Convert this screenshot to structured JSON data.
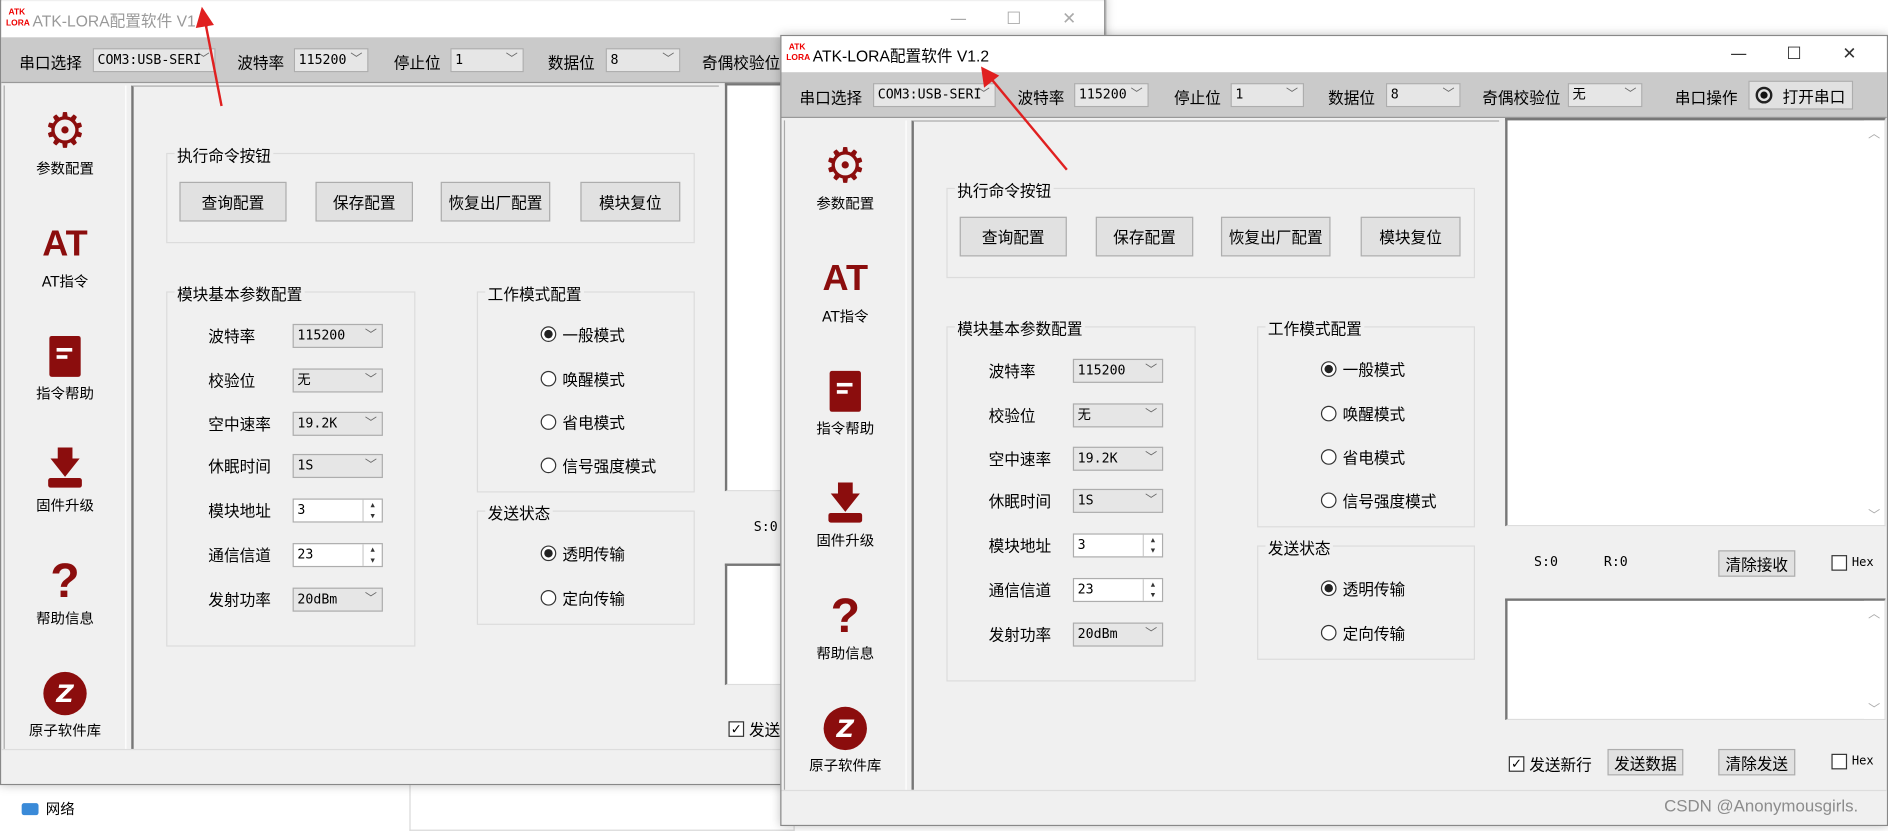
{
  "window": {
    "logo_text": "ATK LORA",
    "title": "ATK-LORA配置软件 V1.2",
    "minimize": "—",
    "maximize": "☐",
    "close": "✕"
  },
  "toolbar": {
    "port_label": "串口选择",
    "port_value": "COM3:USB-SERI",
    "baud_label": "波特率",
    "baud_value": "115200",
    "stop_label": "停止位",
    "stop_value": "1",
    "data_label": "数据位",
    "data_value": "8",
    "parity_label": "奇偶校验位",
    "parity_value": "无",
    "op_label": "串口操作",
    "open_button": "打开串口"
  },
  "sidebar": {
    "items": [
      {
        "label": "参数配置",
        "icon": "gear-icon"
      },
      {
        "label": "AT指令",
        "icon": "at-icon",
        "glyph": "AT"
      },
      {
        "label": "指令帮助",
        "icon": "book-icon"
      },
      {
        "label": "固件升级",
        "icon": "download-icon"
      },
      {
        "label": "帮助信息",
        "icon": "question-icon",
        "glyph": "?"
      },
      {
        "label": "原子软件库",
        "icon": "library-logo-icon"
      }
    ]
  },
  "commands": {
    "title": "执行命令按钮",
    "buttons": [
      "查询配置",
      "保存配置",
      "恢复出厂配置",
      "模块复位"
    ]
  },
  "basic": {
    "title": "模块基本参数配置",
    "rows": [
      {
        "label": "波特率",
        "value": "115200",
        "type": "combo"
      },
      {
        "label": "校验位",
        "value": "无",
        "type": "combo"
      },
      {
        "label": "空中速率",
        "value": "19.2K",
        "type": "combo"
      },
      {
        "label": "休眠时间",
        "value": "1S",
        "type": "combo"
      },
      {
        "label": "模块地址",
        "value": "3",
        "type": "spin"
      },
      {
        "label": "通信信道",
        "value": "23",
        "type": "spin"
      },
      {
        "label": "发射功率",
        "value": "20dBm",
        "type": "combo"
      }
    ]
  },
  "work_mode": {
    "title": "工作模式配置",
    "options": [
      "一般模式",
      "唤醒模式",
      "省电模式",
      "信号强度模式"
    ],
    "selected": 0
  },
  "send_state": {
    "title": "发送状态",
    "options": [
      "透明传输",
      "定向传输"
    ],
    "selected": 0
  },
  "serial": {
    "sent": "S:0",
    "received": "R:0",
    "clear_receive": "清除接收",
    "hex_label": "Hex",
    "send_newline": "发送新行",
    "send_newline_checked": true,
    "send_data": "发送数据",
    "clear_send": "清除发送"
  },
  "desktop": {
    "network_label": "网络"
  },
  "watermark": "CSDN @Anonymousgirls.",
  "colors": {
    "icon_red": "#8b0d0d",
    "arrow": "#e02020",
    "toolbar": "#cacaca"
  }
}
